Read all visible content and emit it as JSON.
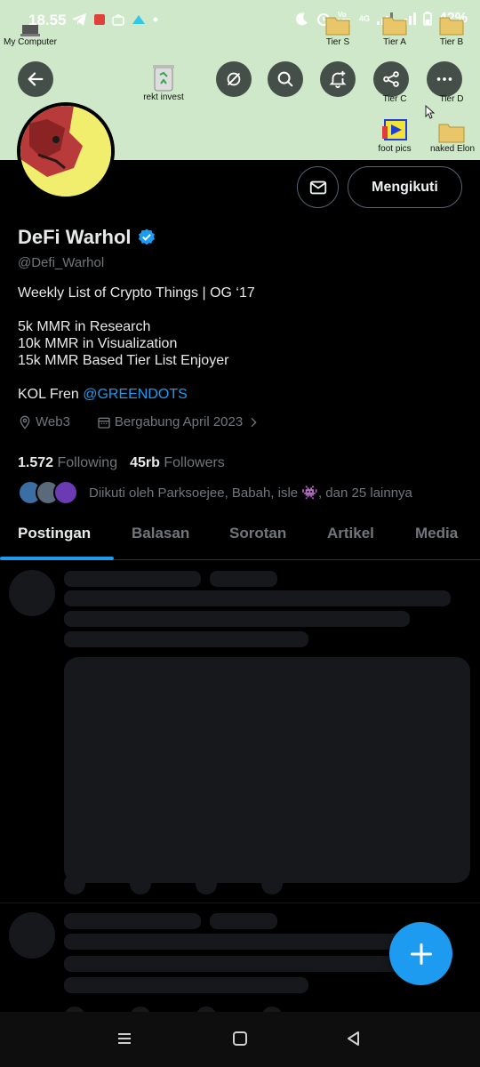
{
  "status": {
    "time": "18.55",
    "network": "4G",
    "volte": "Vo LTE",
    "battery": "42%"
  },
  "desktop": {
    "icons": [
      {
        "name": "my-computer-icon",
        "label": "My Computer"
      },
      {
        "name": "recycle-bin-icon",
        "label": "rekt invest"
      },
      {
        "name": "folder-icon",
        "label": "Tier S"
      },
      {
        "name": "folder-icon",
        "label": "Tier A"
      },
      {
        "name": "folder-icon",
        "label": "Tier B"
      },
      {
        "name": "folder-icon",
        "label": "Tier C"
      },
      {
        "name": "folder-icon",
        "label": "Tier D"
      },
      {
        "name": "media-icon",
        "label": "foot pics"
      },
      {
        "name": "folder-icon",
        "label": "naked Elon"
      }
    ]
  },
  "profile": {
    "display_name": "DeFi Warhol",
    "handle": "@Defi_Warhol",
    "bio": {
      "line1": "Weekly List of Crypto Things | OG ‘17",
      "line2": "5k MMR in Research",
      "line3": "10k MMR in Visualization",
      "line4": "15k MMR Based Tier List Enjoyer",
      "line5_prefix": "KOL Fren ",
      "line5_mention": "@GREENDOTS"
    },
    "location": "Web3",
    "joined": "Bergabung April 2023",
    "following_count": "1.572",
    "following_label": "Following",
    "followers_count": "45rb",
    "followers_label": "Followers",
    "followed_by": "Diikuti oleh Parksoejee, Babah, isle 👾, dan 25 lainnya"
  },
  "actions": {
    "follow_label": "Mengikuti"
  },
  "tabs": [
    {
      "label": "Postingan",
      "active": true
    },
    {
      "label": "Balasan",
      "active": false
    },
    {
      "label": "Sorotan",
      "active": false
    },
    {
      "label": "Artikel",
      "active": false
    },
    {
      "label": "Media",
      "active": false
    }
  ],
  "colors": {
    "accent": "#1d9bf0",
    "background": "#000000",
    "secondary_text": "#71767b"
  }
}
